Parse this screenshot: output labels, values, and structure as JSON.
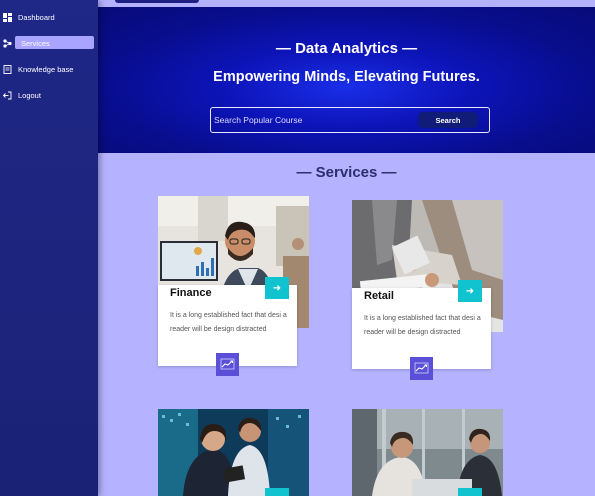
{
  "sidebar": {
    "items": [
      {
        "label": "Dashboard",
        "icon": "dashboard-icon"
      },
      {
        "label": "Services",
        "icon": "services-icon",
        "active": true
      },
      {
        "label": "Knowledge base",
        "icon": "knowledge-base-icon"
      },
      {
        "label": "Logout",
        "icon": "logout-icon"
      }
    ]
  },
  "hero": {
    "title": "— Data Analytics —",
    "subtitle": "Empowering Minds, Elevating Futures.",
    "search": {
      "placeholder": "Search Popular Course",
      "value": "",
      "button_label": "Search"
    }
  },
  "services": {
    "heading": "—  Services  —",
    "cards": [
      {
        "title": "Finance",
        "description": "It is a long established fact that desi a reader will be design distracted",
        "photo": "finance-photo"
      },
      {
        "title": "Retail",
        "description": "It is a long established fact that desi a reader will be design distracted",
        "photo": "retail-photo"
      },
      {
        "photo": "operations-photo"
      },
      {
        "photo": "meeting-photo"
      }
    ]
  },
  "colors": {
    "sidebar_bg": "#1f2787",
    "active_pill": "#a9a4ff",
    "page_bg": "#b5b3ff",
    "hero_center": "#1a2ee8",
    "accent_teal": "#11c2cf",
    "badge_purple": "#5a4fd6"
  }
}
